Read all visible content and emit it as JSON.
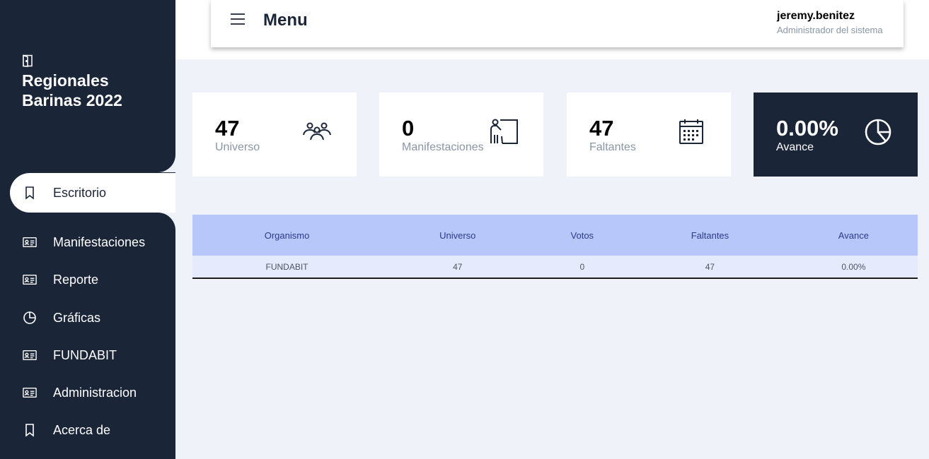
{
  "sidebar": {
    "brand": "Regionales Barinas 2022",
    "brand_icon": "door-open-icon",
    "items": [
      {
        "label": "Escritorio",
        "icon": "bookmark-icon",
        "active": true
      },
      {
        "label": "Manifestaciones",
        "icon": "id-card-icon"
      },
      {
        "label": "Reporte",
        "icon": "id-card-icon"
      },
      {
        "label": "Gráficas",
        "icon": "pie-chart-icon"
      },
      {
        "label": "FUNDABIT",
        "icon": "id-card-icon"
      },
      {
        "label": "Administracion",
        "icon": "id-card-icon"
      },
      {
        "label": "Acerca de",
        "icon": "bookmark-icon"
      }
    ]
  },
  "header": {
    "title": "Menu",
    "user_name": "jeremy.benitez",
    "user_role": "Administrador del sistema"
  },
  "cards": [
    {
      "value": "47",
      "label": "Universo",
      "icon": "people-icon"
    },
    {
      "value": "0",
      "label": "Manifestaciones",
      "icon": "presenter-board-icon"
    },
    {
      "value": "47",
      "label": "Faltantes",
      "icon": "calendar-icon"
    },
    {
      "value": "0.00%",
      "label": "Avance",
      "icon": "pie-chart-icon"
    }
  ],
  "table": {
    "headers": [
      "Organismo",
      "Universo",
      "Votos",
      "Faltantes",
      "Avance"
    ],
    "rows": [
      [
        "FUNDABIT",
        "47",
        "0",
        "47",
        "0.00%"
      ]
    ]
  },
  "colors": {
    "sidebar_bg": "#1b2538",
    "page_bg": "#eff2f8",
    "table_header_bg": "#b8c7fa",
    "table_row_bg": "#e5ebfd",
    "accent_dark": "#1b2538"
  }
}
